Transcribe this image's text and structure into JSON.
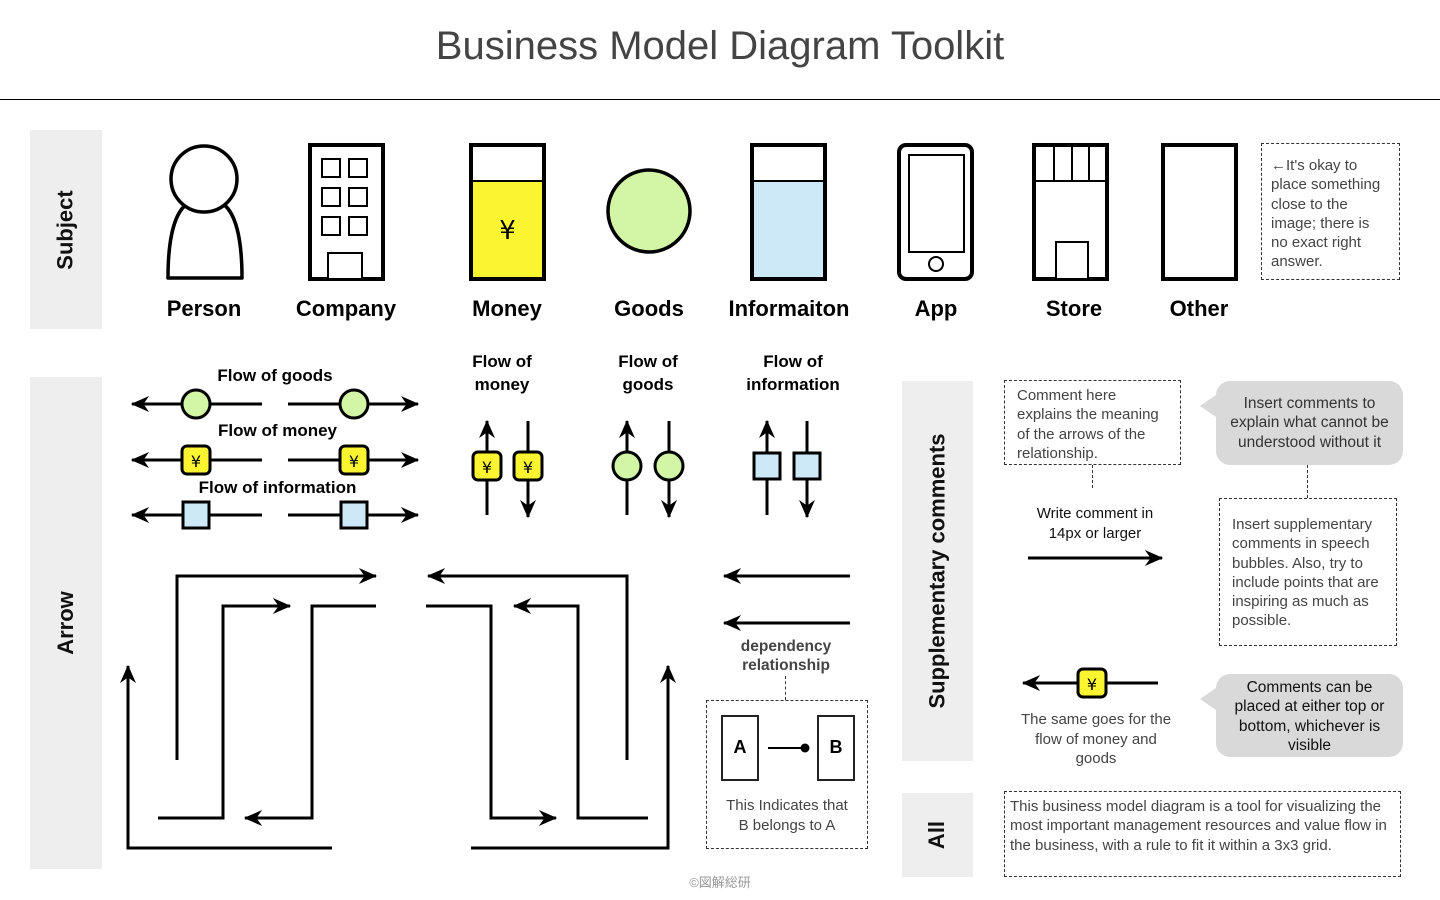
{
  "title": "Business Model Diagram Toolkit",
  "sections": {
    "subject": "Subject",
    "arrow": "Arrow",
    "supplementary": "Supplementary comments",
    "all": "All"
  },
  "subjects": [
    {
      "label": "Person",
      "icon": "person-icon"
    },
    {
      "label": "Company",
      "icon": "company-building-icon"
    },
    {
      "label": "Money",
      "icon": "money-icon",
      "symbol": "¥"
    },
    {
      "label": "Goods",
      "icon": "goods-circle-icon"
    },
    {
      "label": "Informaiton",
      "icon": "information-icon"
    },
    {
      "label": "App",
      "icon": "smartphone-app-icon"
    },
    {
      "label": "Store",
      "icon": "store-icon"
    },
    {
      "label": "Other",
      "icon": "other-rectangle-icon"
    }
  ],
  "subject_note": "←It's okay to place something close to the image; there is no exact right answer.",
  "arrows": {
    "horizontal_flows": [
      {
        "label": "Flow of goods",
        "marker": "circle"
      },
      {
        "label": "Flow of money",
        "marker": "yen",
        "symbol": "¥"
      },
      {
        "label": "Flow of information",
        "marker": "square"
      }
    ],
    "vertical_flows": [
      {
        "label_line1": "Flow of",
        "label_line2": "money",
        "marker": "yen",
        "symbol": "¥"
      },
      {
        "label_line1": "Flow of",
        "label_line2": "goods",
        "marker": "circle"
      },
      {
        "label_line1": "Flow of",
        "label_line2": "information",
        "marker": "square"
      }
    ],
    "dependency": {
      "label_line1": "dependency",
      "label_line2": "relationship",
      "box_a": "A",
      "box_b": "B",
      "caption_line1": "This Indicates that",
      "caption_line2": "B belongs to A"
    }
  },
  "supplementary": {
    "dashed_note": "Comment here explains the meaning of the arrows of the relationship.",
    "write_comment_line1": "Write comment  in",
    "write_comment_line2": "14px or larger",
    "bubble_top": "Insert comments to explain what cannot be understood without it",
    "dashed_note_right": "Insert supplementary comments in speech bubbles. Also, try to include points that are inspiring as much as possible.",
    "money_symbol": "¥",
    "money_caption": "The same goes for the flow of money and goods",
    "bubble_bottom": "Comments can be placed at either top or bottom, whichever is visible"
  },
  "all_note": "This business model diagram is a tool for visualizing the most important management resources and value flow in the business, with a rule to fit it within a 3x3 grid.",
  "footer": "©図解総研",
  "colors": {
    "money_yellow": "#faf431",
    "goods_green": "#d3f5a6",
    "info_blue": "#cde8f7",
    "label_gray": "#eeeeee",
    "bubble_gray": "#d9d9d9"
  }
}
